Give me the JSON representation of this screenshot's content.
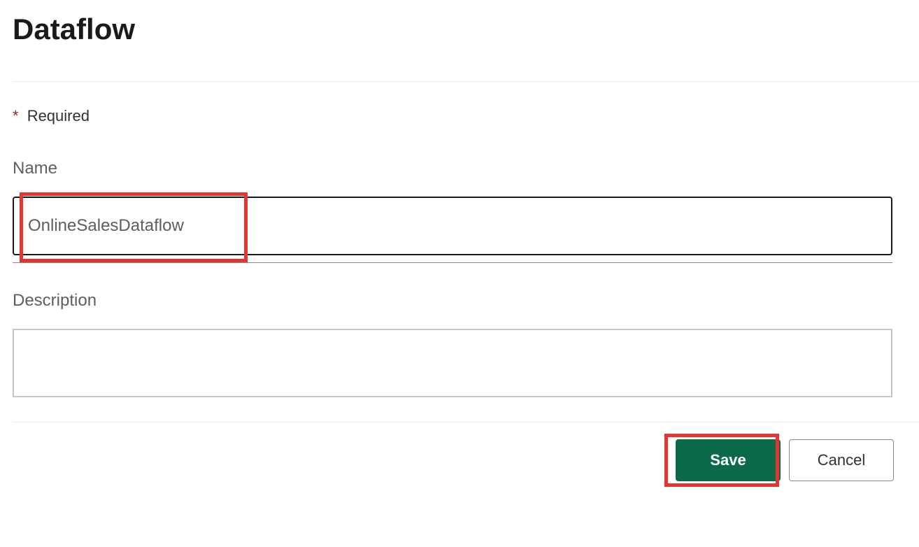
{
  "dialog": {
    "title": "Dataflow",
    "required_marker": "*",
    "required_text": "Required",
    "name_label": "Name",
    "name_value": "OnlineSalesDataflow",
    "description_label": "Description",
    "description_value": "",
    "save_label": "Save",
    "cancel_label": "Cancel"
  }
}
